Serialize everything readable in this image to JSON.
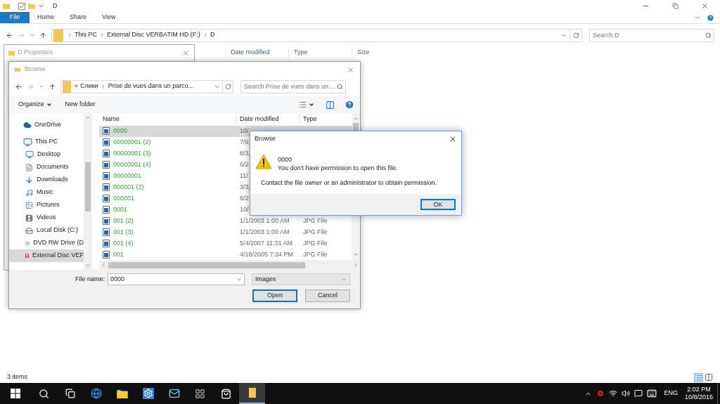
{
  "explorer": {
    "title": "D",
    "ribbon_tabs": [
      {
        "label": "File",
        "kind": "file"
      },
      {
        "label": "Home",
        "kind": "tab"
      },
      {
        "label": "Share",
        "kind": "tab"
      },
      {
        "label": "View",
        "kind": "tab"
      }
    ],
    "breadcrumb": [
      "This PC",
      "External Disc VERBATIM HD (F:)",
      "D"
    ],
    "search": {
      "placeholder": "Search D"
    },
    "columns": [
      "Date modified",
      "Type",
      "Size"
    ],
    "status_bar": "3 items"
  },
  "properties_window": {
    "title": "D Properties"
  },
  "browse_dialog": {
    "title": "Browse",
    "breadcrumb_prefix": "«",
    "breadcrumb": [
      "Слики",
      "Prise de vues dans un parco..."
    ],
    "search": {
      "placeholder": "Search Prise de vues dans un ..."
    },
    "toolbar": [
      "Organize",
      "New folder"
    ],
    "nav": [
      {
        "label": "OneDrive",
        "selected": false
      },
      {
        "label": "This PC",
        "selected": false,
        "children": [
          {
            "label": "Desktop",
            "selected": false
          },
          {
            "label": "Documents",
            "selected": false
          },
          {
            "label": "Downloads",
            "selected": false
          },
          {
            "label": "Music",
            "selected": false
          },
          {
            "label": "Pictures",
            "selected": false
          },
          {
            "label": "Videos",
            "selected": false
          },
          {
            "label": "Local Disk (C:)",
            "selected": false
          },
          {
            "label": "DVD RW Drive (D",
            "selected": false
          },
          {
            "label": "External Disc VEF",
            "selected": true
          }
        ]
      }
    ],
    "columns": [
      "Name",
      "Date modified",
      "Type"
    ],
    "files": [
      {
        "name": "0000",
        "date": "10/",
        "selected": true
      },
      {
        "name": "00000001 (2)",
        "date": "7/9,",
        "selected": false
      },
      {
        "name": "00000001 (3)",
        "date": "8/3,",
        "selected": false
      },
      {
        "name": "00000001 (4)",
        "date": "6/2",
        "selected": false
      },
      {
        "name": "00000001",
        "date": "11/",
        "selected": false
      },
      {
        "name": "000001 (2)",
        "date": "3/3,",
        "selected": false
      },
      {
        "name": "000001",
        "date": "6/2",
        "selected": false
      },
      {
        "name": "0001",
        "date": "10/",
        "selected": false
      },
      {
        "name": "001 (2)",
        "date": "1/1/2003 1:00 AM",
        "type": "JPG File",
        "selected": false
      },
      {
        "name": "001 (3)",
        "date": "1/1/2003 1:00 AM",
        "type": "JPG File",
        "selected": false
      },
      {
        "name": "001 (4)",
        "date": "5/4/2007 11:31 AM",
        "type": "JPG File",
        "selected": false
      },
      {
        "name": "001",
        "date": "4/18/2005 7:34 PM",
        "type": "JPG File",
        "selected": false
      }
    ],
    "file_name_label": "File name:",
    "file_name": "0000",
    "file_type": "Images",
    "buttons": [
      "Open",
      "Cancel"
    ]
  },
  "error_dialog": {
    "title": "Browse",
    "file": "0000",
    "message": "You don't have permission to open this file.",
    "detail": "Contact the file owner or an administrator to obtain permission.",
    "button": "OK"
  },
  "taskbar": {
    "apps": [
      {
        "active": false
      },
      {
        "active": false
      },
      {
        "active": false
      },
      {
        "active": false
      },
      {
        "active": false
      },
      {
        "active": false
      },
      {
        "active": false
      },
      {
        "active": false
      },
      {
        "active": true
      }
    ],
    "language": "ENG",
    "time": "2:02 PM",
    "date": "10/8/2015"
  }
}
